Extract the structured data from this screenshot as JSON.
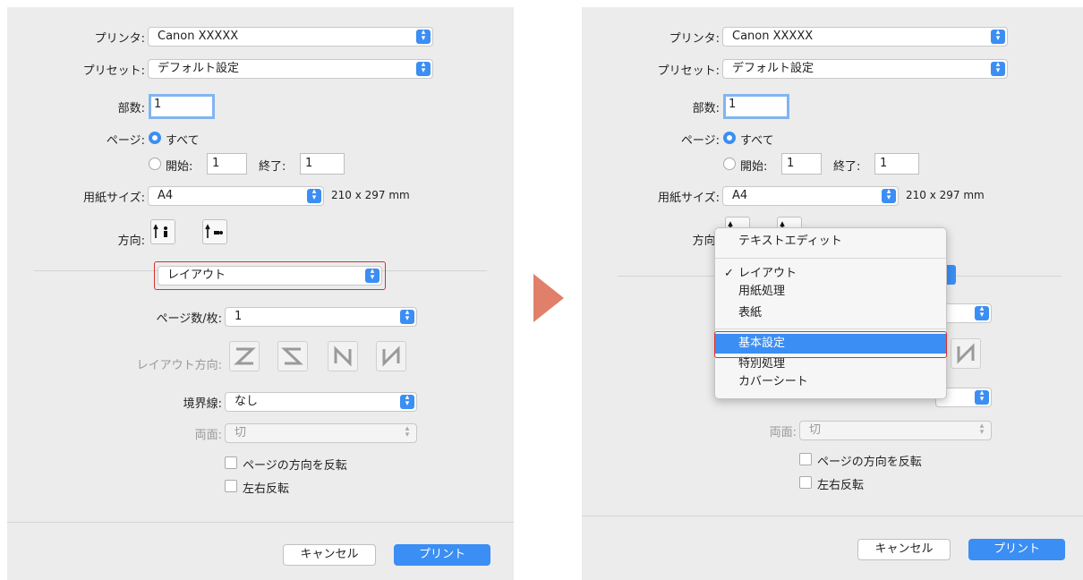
{
  "dialog": {
    "printer_label": "プリンタ:",
    "printer_value": "Canon XXXXX",
    "preset_label": "プリセット:",
    "preset_value": "デフォルト設定",
    "copies_label": "部数:",
    "copies_value": "1",
    "pages_label": "ページ:",
    "pages_all": "すべて",
    "pages_from_label": "開始:",
    "pages_from_value": "1",
    "pages_to_label": "終了:",
    "pages_to_value": "1",
    "paper_size_label": "用紙サイズ:",
    "paper_size_value": "A4",
    "paper_size_dims": "210 x 297 mm",
    "orientation_label": "方向:",
    "section_value": "レイアウト",
    "pages_per_sheet_label": "ページ数/枚:",
    "pages_per_sheet_value": "1",
    "layout_direction_label": "レイアウト方向:",
    "border_label": "境界線:",
    "border_value": "なし",
    "duplex_label": "両面:",
    "duplex_value": "切",
    "reverse_orientation": "ページの方向を反転",
    "flip_horizontal": "左右反転",
    "cancel_button": "キャンセル",
    "print_button": "プリント"
  },
  "menu": {
    "items": [
      {
        "label": "テキストエディット",
        "checked": false,
        "selected": false
      },
      {
        "label": "レイアウト",
        "checked": true,
        "selected": false
      },
      {
        "label": "用紙処理",
        "checked": false,
        "selected": false
      },
      {
        "label": "表紙",
        "checked": false,
        "selected": false
      },
      {
        "label": "基本設定",
        "checked": false,
        "selected": true
      },
      {
        "label": "特別処理",
        "checked": false,
        "selected": false
      },
      {
        "label": "カバーシート",
        "checked": false,
        "selected": false
      }
    ],
    "checkmark": "✓"
  },
  "colors": {
    "accent": "#3b8ef3",
    "highlight_box": "#d9302f",
    "arrow": "#e0806a",
    "panel_bg": "#ececec"
  },
  "icons": {
    "stepper": "updown-chevron-icon",
    "orientation_portrait": "portrait-orientation-icon",
    "orientation_landscape": "landscape-orientation-icon",
    "layout_z": "layout-z-icon",
    "layout_s": "layout-s-icon",
    "layout_n_reverse": "layout-n-reverse-icon",
    "layout_n": "layout-n-icon",
    "step_arrow": "next-step-arrow-icon"
  }
}
